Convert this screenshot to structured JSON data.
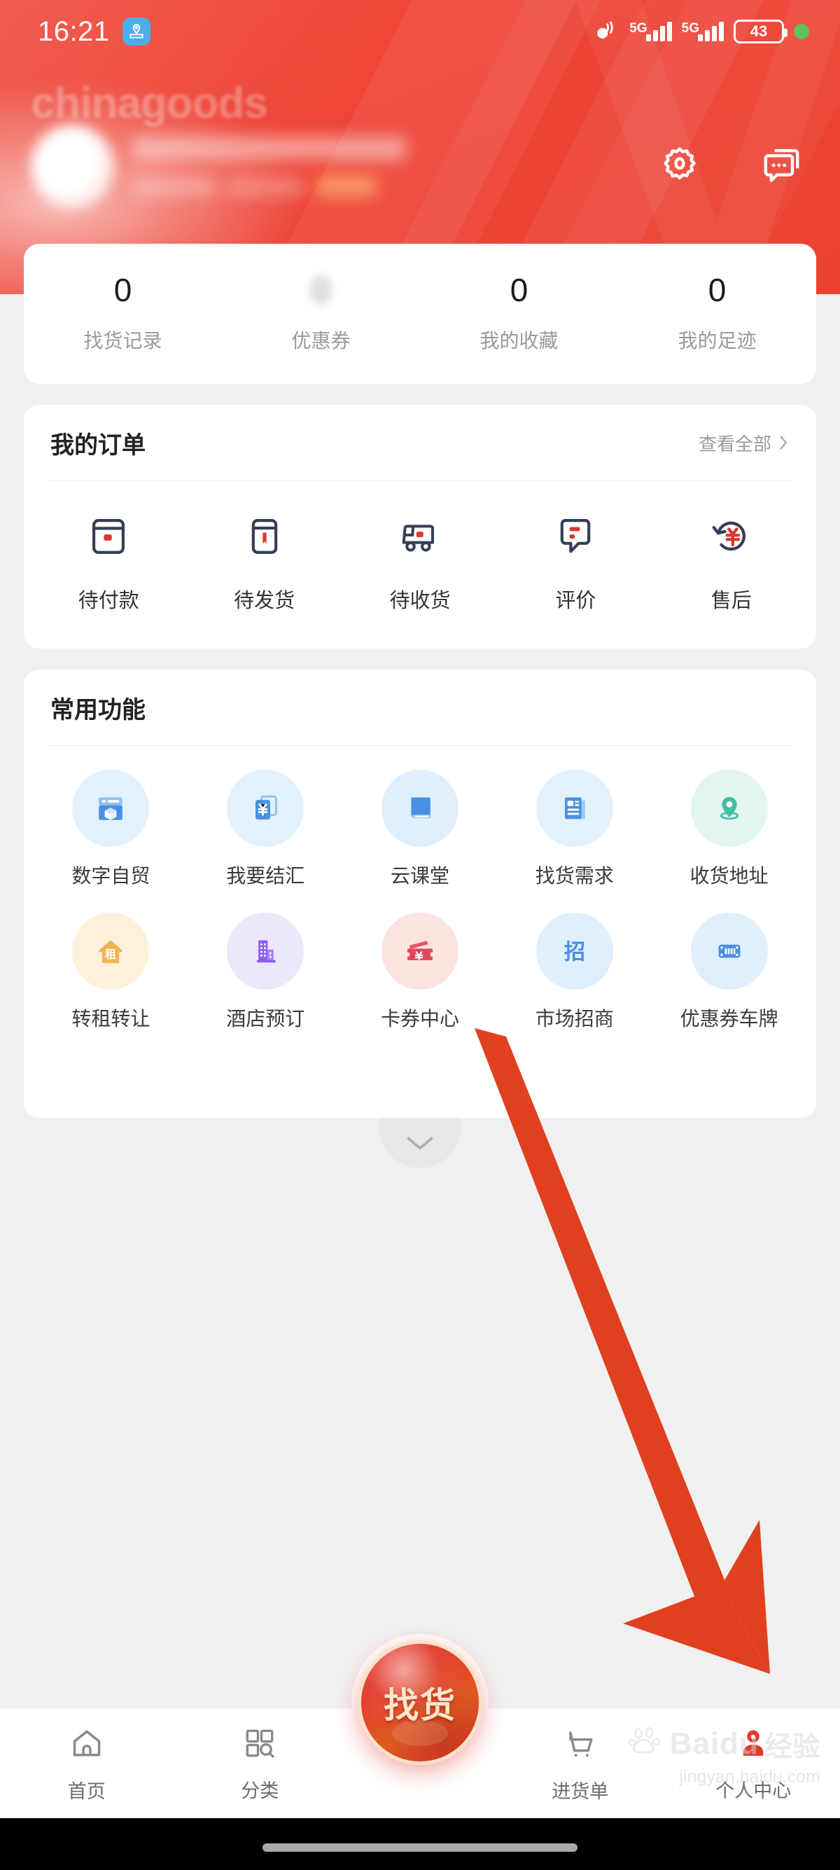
{
  "statusbar": {
    "time": "16:21",
    "app_icon": "location-stamp-icon",
    "network_labels": [
      "5G",
      "5G"
    ],
    "battery_level": "43",
    "indicator_dot": "green-status-dot"
  },
  "header": {
    "brand_wordmark": "chinagoods",
    "avatar": "user-avatar-blurred",
    "username": "",
    "settings_icon": "gear-icon",
    "message_icon": "chat-bubble-icon"
  },
  "stats": [
    {
      "value": "0",
      "label": "找货记录",
      "blurred": false
    },
    {
      "value": "0",
      "label": "优惠券",
      "blurred": true
    },
    {
      "value": "0",
      "label": "我的收藏",
      "blurred": false
    },
    {
      "value": "0",
      "label": "我的足迹",
      "blurred": false
    }
  ],
  "orders": {
    "title": "我的订单",
    "more_label": "查看全部",
    "items": [
      {
        "label": "待付款",
        "icon": "wallet-icon"
      },
      {
        "label": "待发货",
        "icon": "package-box-icon"
      },
      {
        "label": "待收货",
        "icon": "delivery-truck-icon"
      },
      {
        "label": "评价",
        "icon": "comment-icon"
      },
      {
        "label": "售后",
        "icon": "refund-yen-icon"
      }
    ]
  },
  "functions": {
    "title": "常用功能",
    "items": [
      {
        "label": "数字自贸",
        "icon": "digital-trade-box-icon",
        "bg": "#e4f2fd",
        "fg": "#4a90e2"
      },
      {
        "label": "我要结汇",
        "icon": "settlement-yen-doc-icon",
        "bg": "#e4f2fd",
        "fg": "#4a90e2"
      },
      {
        "label": "云课堂",
        "icon": "book-icon",
        "bg": "#e0f0fd",
        "fg": "#4a90e2"
      },
      {
        "label": "找货需求",
        "icon": "news-document-icon",
        "bg": "#e4f2fd",
        "fg": "#4a90e2"
      },
      {
        "label": "收货地址",
        "icon": "location-pin-icon",
        "bg": "#e3f5ef",
        "fg": "#45bda4"
      },
      {
        "label": "转租转让",
        "icon": "house-rent-icon",
        "bg": "#fdf1dd",
        "fg": "#efb martin"
      },
      {
        "label": "酒店预订",
        "icon": "hotel-building-icon",
        "bg": "#ece7fb",
        "fg": "#8b5cf6"
      },
      {
        "label": "卡券中心",
        "icon": "coupon-ticket-icon",
        "bg": "#fbe3e0",
        "fg": "#e0485a"
      },
      {
        "label": "市场招商",
        "icon": "investment-zhao-icon",
        "bg": "#e0f0fd",
        "fg": "#4a90e2"
      },
      {
        "label": "优惠券车牌",
        "icon": "license-plate-icon",
        "bg": "#e0f0fd",
        "fg": "#4a90e2"
      }
    ],
    "expand_icon": "chevron-down-icon"
  },
  "tabbar": {
    "items": [
      {
        "label": "首页",
        "icon": "home-icon",
        "active": false
      },
      {
        "label": "分类",
        "icon": "category-search-icon",
        "active": false
      },
      {
        "label": "进货单",
        "icon": "shopping-cart-icon",
        "active": false
      },
      {
        "label": "个人中心",
        "icon": "person-icon",
        "active": true
      }
    ],
    "fab_label": "找货",
    "active_color": "#e03a2c"
  },
  "watermark": {
    "brand": "Baidu",
    "suffix": "经验",
    "url": "jingyan.baidu.com"
  },
  "annotation": {
    "type": "arrow",
    "color": "#e0401f",
    "points_to": "个人中心"
  }
}
